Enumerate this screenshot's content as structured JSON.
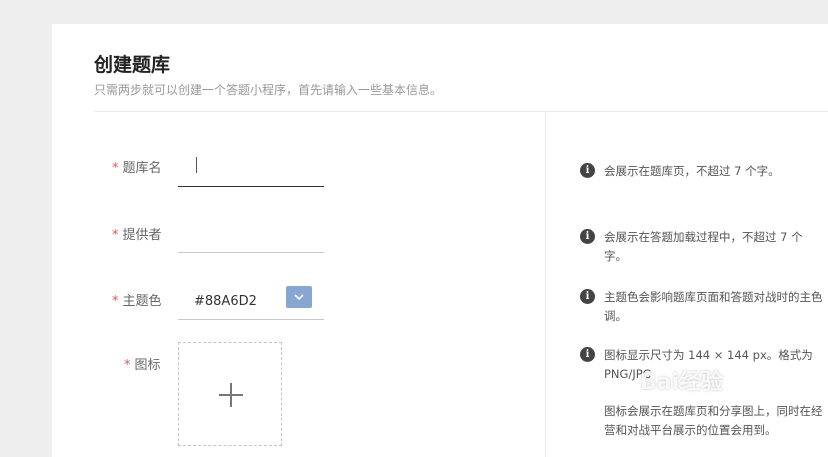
{
  "header": {
    "title": "创建题库",
    "subtitle": "只需两步就可以创建一个答题小程序，首先请输入一些基本信息。"
  },
  "form": {
    "required_mark": "*",
    "name_label": "题库名",
    "name_value": "",
    "provider_label": "提供者",
    "provider_value": "",
    "theme_label": "主题色",
    "theme_value": "#88A6D2",
    "icon_label": "图标"
  },
  "hints": {
    "name": "会展示在题库页，不超过 7 个字。",
    "provider": "会展示在答题加载过程中，不超过 7 个字。",
    "theme": "主题色会影响题库页面和答题对战时的主色调。",
    "icon": "图标显示尺寸为 144 × 144 px。格式为 PNG/JPG",
    "icon_extra": "图标会展示在题库页和分享图上，同时在经营和对战平台展示的位置会用到。"
  },
  "watermark": "Bai经验",
  "colors": {
    "theme": "#88A6D2",
    "required": "#e05a5a"
  },
  "icons": {
    "info": "info-icon",
    "dropdown": "chevron-down-icon",
    "upload": "plus-icon"
  }
}
